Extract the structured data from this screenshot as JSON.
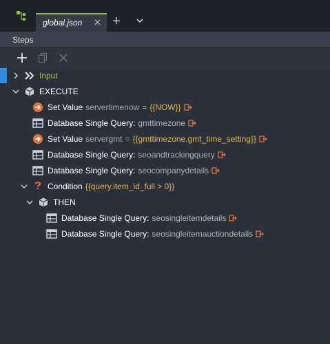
{
  "tab": {
    "title": "global.json",
    "close_glyph": "✕",
    "add_glyph": "+",
    "icons": [
      "flow-icon",
      "chevron-down-icon"
    ]
  },
  "panel": {
    "title": "Steps"
  },
  "toolbar": {
    "icons": [
      "add-icon",
      "copy-icon",
      "delete-icon"
    ]
  },
  "colors": {
    "accent_tab": "#8fbd4a",
    "selection": "#2f8fdd",
    "expression": "#e3b655",
    "step_orange": "#e0703a",
    "input_green": "#98c84a"
  },
  "tree": {
    "input": {
      "label": "Input"
    },
    "execute": {
      "label": "EXECUTE"
    },
    "step1": {
      "label": "Set Value",
      "name": "servertimenow",
      "eq": "=",
      "expr": "{{NOW}}"
    },
    "step2": {
      "label": "Database Single Query:",
      "name": "gmttimezone"
    },
    "step3": {
      "label": "Set Value",
      "name": "servergmt",
      "eq": "=",
      "expr": "{{gmttimezone.gmt_time_setting}}"
    },
    "step4": {
      "label": "Database Single Query:",
      "name": "seoandtrackingquery"
    },
    "step5": {
      "label": "Database Single Query:",
      "name": "seocompanydetails"
    },
    "condition": {
      "label": "Condition",
      "expr": "{{query.item_id_full > 0}}"
    },
    "then": {
      "label": "THEN"
    },
    "step6": {
      "label": "Database Single Query:",
      "name": "seosingleitemdetails"
    },
    "step7": {
      "label": "Database Single Query:",
      "name": "seosingleitemauctiondetails"
    }
  }
}
